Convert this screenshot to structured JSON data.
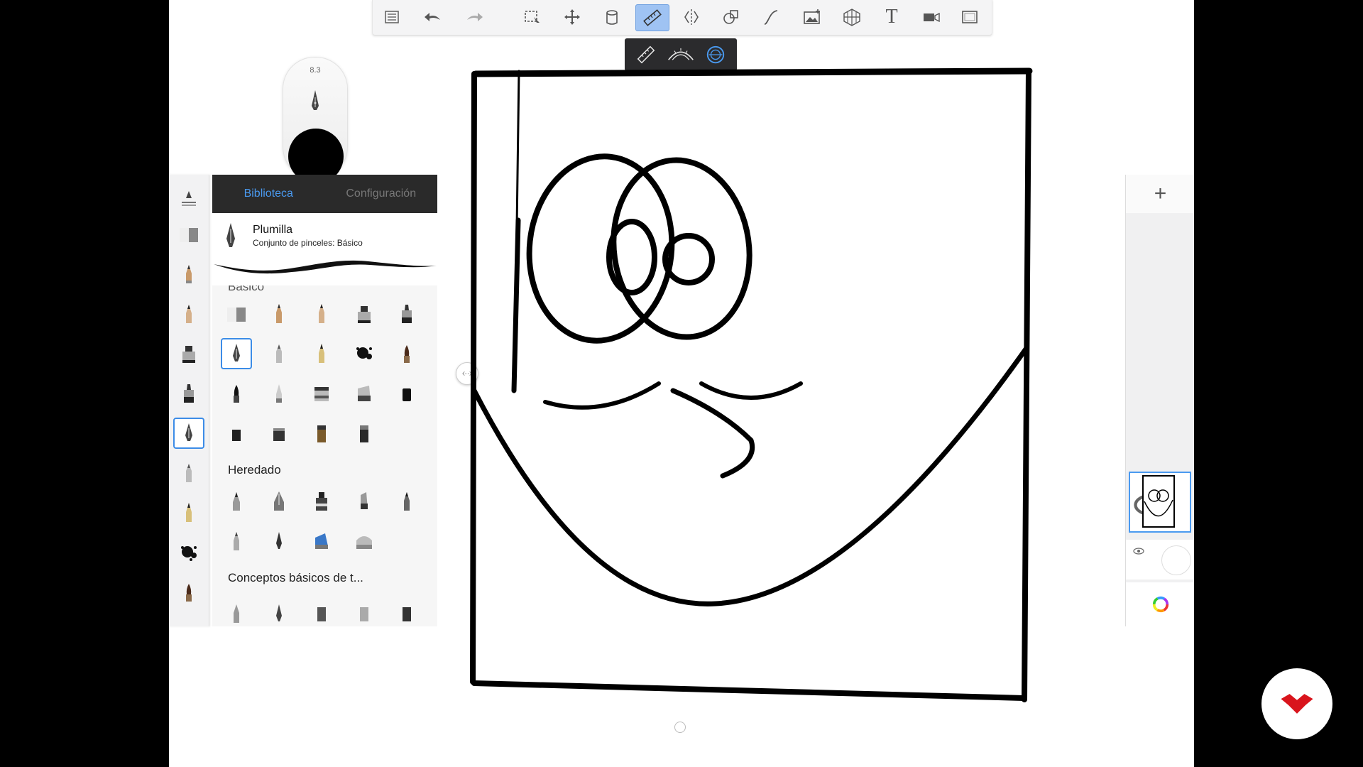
{
  "toolbar": {
    "items": [
      {
        "name": "brush-library-button",
        "icon": "list-icon"
      },
      {
        "name": "undo-button",
        "icon": "undo-arrow-icon"
      },
      {
        "name": "redo-button",
        "icon": "redo-arrow-icon"
      },
      {
        "name": "selection-tool-button",
        "icon": "selection-icon"
      },
      {
        "name": "transform-tool-button",
        "icon": "move-arrows-icon"
      },
      {
        "name": "fill-tool-button",
        "icon": "paint-bucket-icon"
      },
      {
        "name": "ruler-tool-button",
        "icon": "ruler-icon",
        "active": true
      },
      {
        "name": "symmetry-tool-button",
        "icon": "symmetry-icon"
      },
      {
        "name": "shape-tool-button",
        "icon": "shapes-icon"
      },
      {
        "name": "stroke-tool-button",
        "icon": "curve-stroke-icon"
      },
      {
        "name": "image-import-button",
        "icon": "image-icon"
      },
      {
        "name": "perspective-guide-button",
        "icon": "perspective-grid-icon"
      },
      {
        "name": "text-tool-button",
        "icon": "text-icon",
        "label": "T"
      },
      {
        "name": "record-time-lapse-button",
        "icon": "video-camera-icon"
      },
      {
        "name": "fullscreen-button",
        "icon": "fullscreen-icon"
      }
    ]
  },
  "ruler_popover": {
    "options": [
      "ruler-straight-icon",
      "ruler-french-curve-icon",
      "ruler-ellipse-icon"
    ],
    "active_index": 2
  },
  "brush_puck": {
    "size_value": "8.3",
    "color": "#000000"
  },
  "library": {
    "tab_library": "Biblioteca",
    "tab_settings": "Configuración",
    "current_brush_name": "Plumilla",
    "current_brush_set": "Conjunto de pinceles: Básico",
    "section_basic_partial": "Básico",
    "section_legacy": "Heredado",
    "section_concepts": "Conceptos básicos de t..."
  },
  "colors": {
    "accent": "#4a9af0",
    "toolbar_bg": "#f4f4f5",
    "tab_bar_bg": "#2a2a2a",
    "brand": "#d9141c"
  }
}
